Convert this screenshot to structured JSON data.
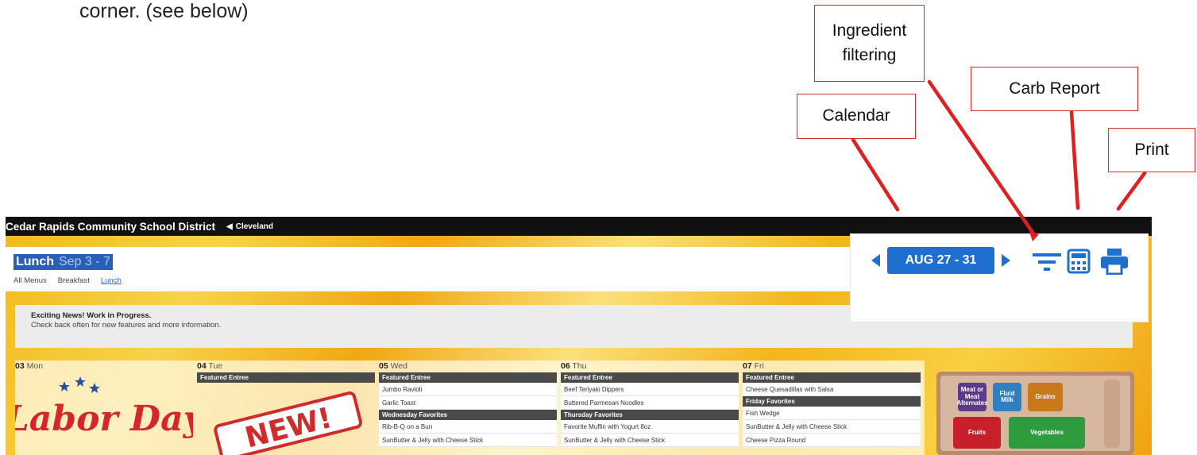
{
  "document": {
    "text": "corner.  (see below)"
  },
  "callouts": {
    "ingredient_filtering": "Ingredient filtering",
    "carb_report": "Carb Report",
    "calendar": "Calendar",
    "print": "Print",
    "color": "#d92b2b"
  },
  "site": {
    "district": "Cedar Rapids Community School District",
    "school": "Cleveland"
  },
  "menu": {
    "meal": "Lunch",
    "dates": "Sep 3 - 7",
    "tabs": [
      "All Menus",
      "Breakfast",
      "Lunch"
    ],
    "active_tab": "Lunch"
  },
  "news": {
    "title": "Exciting News! Work in Progress.",
    "body": "Check back often for new features and more information."
  },
  "toolbar": {
    "week_label": "AUG 27 - 31",
    "accent": "#1f6fd1"
  },
  "days": [
    {
      "num": "03",
      "dow": "Mon",
      "sections": []
    },
    {
      "num": "04",
      "dow": "Tue",
      "sections": [
        {
          "title": "Featured Entree",
          "items": []
        }
      ]
    },
    {
      "num": "05",
      "dow": "Wed",
      "sections": [
        {
          "title": "Featured Entree",
          "items": [
            "Jumbo Ravioli",
            "Garlic Toast"
          ]
        },
        {
          "title": "Wednesday Favorites",
          "items": [
            "Rib-B-Q on a Bun",
            "SunButter & Jelly with Cheese Stick"
          ]
        }
      ]
    },
    {
      "num": "06",
      "dow": "Thu",
      "sections": [
        {
          "title": "Featured Entree",
          "items": [
            "Beef Teriyaki Dippers",
            "Buttered Parmesan Noodles"
          ]
        },
        {
          "title": "Thursday Favorites",
          "items": [
            "Favorite Muffin with Yogurt 8oz",
            "SunButter & Jelly with Cheese Stick"
          ]
        }
      ]
    },
    {
      "num": "07",
      "dow": "Fri",
      "sections": [
        {
          "title": "Featured Entree",
          "items": [
            "Cheese Quesadillas with Salsa"
          ]
        },
        {
          "title": "Friday Favorites",
          "items": [
            "Fish Wedge",
            "SunButter & Jelly with Cheese Stick",
            "Cheese Pizza Round"
          ]
        }
      ]
    }
  ],
  "plate": {
    "tiles": [
      {
        "label": "Meat or Meat Alternates",
        "color": "#5b3a8c"
      },
      {
        "label": "Fluid Milk",
        "color": "#2f7fc1"
      },
      {
        "label": "Grains",
        "color": "#c9781c"
      },
      {
        "label": "Fruits",
        "color": "#c8202b"
      },
      {
        "label": "Vegetables",
        "color": "#2e9b3e"
      }
    ]
  },
  "images": {
    "labor_day": "Labor Day",
    "new_badge": "NEW!"
  }
}
